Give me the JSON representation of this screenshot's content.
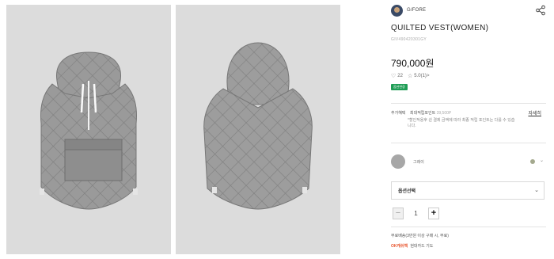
{
  "brand": {
    "name": "G/FORE",
    "logo_icon": "brand-avatar-icon",
    "share_icon": "share-icon"
  },
  "product": {
    "title": "QUILTED VEST(WOMEN)",
    "code": "GIV490420301GY",
    "price": "790,000원",
    "likes": "22",
    "rating": "5.0(1)",
    "rating_more": ">",
    "badge": "옵션변경"
  },
  "benefits": {
    "label": "추가혜택",
    "main": "최대적립포인트",
    "points": "39,500P",
    "note": "*할인적용후 쉰 결제 금액에 따라 최종 적립 포인트는 다를 수 있습니다.",
    "detail_link": "자세히"
  },
  "color": {
    "name": "그레이",
    "swatch": "#a7a7a7",
    "dot": "#a4a98e"
  },
  "option": {
    "placeholder": "옵션선택"
  },
  "quantity": {
    "minus": "−",
    "value": "1",
    "plus": "+"
  },
  "shipping": {
    "text": "무료배송(3만원 이상 구매 시, 무료)"
  },
  "cashback": {
    "logo": "OK캐쉬백",
    "text": "현대카드 기도"
  },
  "colors": {
    "background": "#dcdcdc",
    "vest": "#9b9b9b",
    "badge": "#1f9d55"
  }
}
